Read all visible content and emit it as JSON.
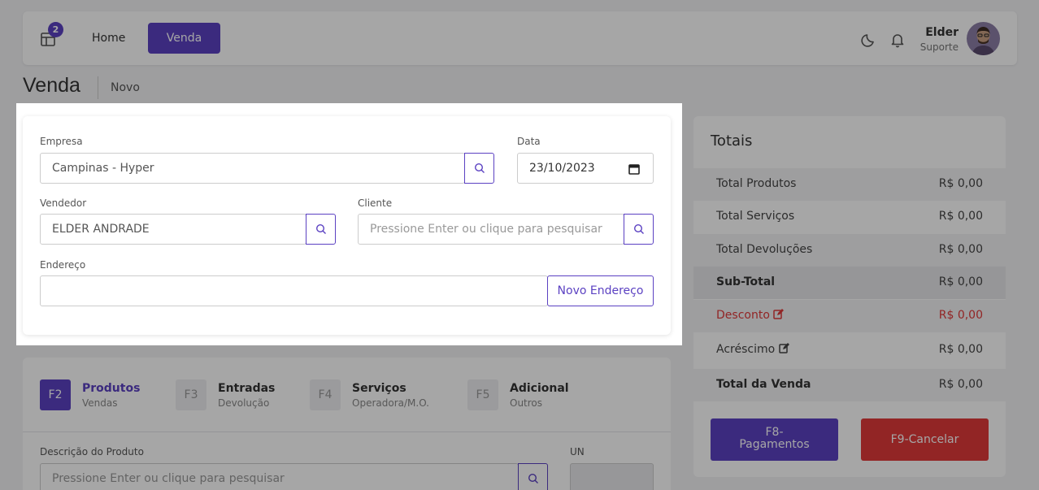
{
  "header": {
    "badge_count": "2",
    "nav_home": "Home",
    "nav_venda": "Venda",
    "user_name": "Elder",
    "user_role": "Suporte"
  },
  "page": {
    "title": "Venda",
    "subtitle": "Novo"
  },
  "form": {
    "empresa_label": "Empresa",
    "empresa_value": "Campinas - Hyper",
    "data_label": "Data",
    "data_value": "23/10/2023",
    "vendedor_label": "Vendedor",
    "vendedor_value": "ELDER ANDRADE",
    "cliente_label": "Cliente",
    "cliente_placeholder": "Pressione Enter ou clique para pesquisar",
    "endereco_label": "Endereço",
    "endereco_value": "",
    "novo_endereco": "Novo Endereço"
  },
  "tabs": [
    {
      "key": "F2",
      "title": "Produtos",
      "sub": "Vendas",
      "active": true
    },
    {
      "key": "F3",
      "title": "Entradas",
      "sub": "Devolução",
      "active": false
    },
    {
      "key": "F4",
      "title": "Serviços",
      "sub": "Operadora/M.O.",
      "active": false
    },
    {
      "key": "F5",
      "title": "Adicional",
      "sub": "Outros",
      "active": false
    }
  ],
  "product": {
    "desc_label": "Descrição do Produto",
    "desc_placeholder": "Pressione Enter ou clique para pesquisar",
    "un_label": "UN"
  },
  "totals": {
    "title": "Totais",
    "rows": [
      {
        "label": "Total Produtos",
        "value": "R$ 0,00"
      },
      {
        "label": "Total Serviços",
        "value": "R$ 0,00"
      },
      {
        "label": "Total Devoluções",
        "value": "R$ 0,00"
      },
      {
        "label": "Sub-Total",
        "value": "R$ 0,00"
      },
      {
        "label": "Desconto",
        "value": "R$ 0,00"
      },
      {
        "label": "Acréscimo",
        "value": "R$ 0,00"
      },
      {
        "label": "Total da Venda",
        "value": "R$ 0,00"
      }
    ],
    "pay_button_line1": "F8-",
    "pay_button_line2": "Pagamentos",
    "cancel_button": "F9-Cancelar"
  },
  "colors": {
    "accent": "#5b41c2",
    "danger": "#e03a3a"
  },
  "icons": [
    "layout-icon",
    "moon-icon",
    "bell-icon",
    "search-icon",
    "chevron-down-icon",
    "edit-icon",
    "calendar-icon"
  ]
}
